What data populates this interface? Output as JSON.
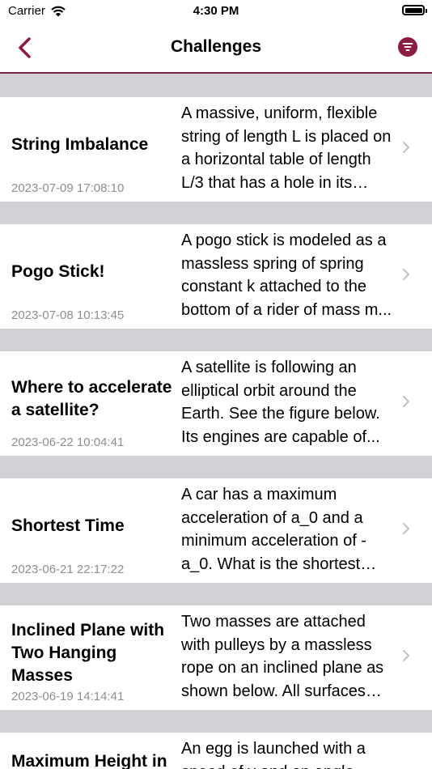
{
  "status_bar": {
    "carrier": "Carrier",
    "time": "4:30 PM"
  },
  "nav": {
    "title": "Challenges"
  },
  "challenges": [
    {
      "title": "String Imbalance",
      "date": "2023-07-09 17:08:10",
      "description": " A massive, uniform, flexible string of length L is placed on a horizontal table of length L/3 that has a hole in its center..."
    },
    {
      "title": "Pogo Stick!",
      "date": "2023-07-08 10:13:45",
      "description": " A pogo stick is modeled as a massless spring of spring constant k attached to the bottom of a rider of mass m..."
    },
    {
      "title": "Where to accelerate a satellite?",
      "date": "2023-06-22 10:04:41",
      "description": " A satellite is following an elliptical orbit around the Earth. See the figure below. Its engines are capable of..."
    },
    {
      "title": "Shortest Time",
      "date": "2023-06-21 22:17:22",
      "description": " A car has a maximum acceleration of a_0 and a minimum acceleration of -a_0. What is the shortest time needed..."
    },
    {
      "title": "Inclined Plane with Two Hanging Masses",
      "date": "2023-06-19 14:14:41",
      "description": " Two masses are attached with pulleys by a massless rope on an inclined plane as shown below. All surfaces are frictionless..."
    },
    {
      "title": "Maximum Height in",
      "date": "",
      "description": "An egg is launched with a speed of v and an angle theta from the ground..."
    }
  ]
}
